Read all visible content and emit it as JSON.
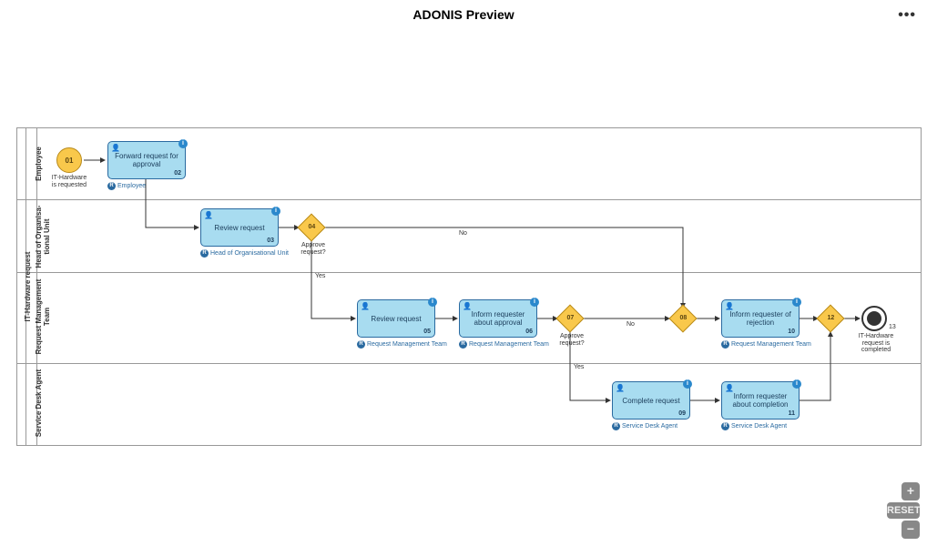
{
  "header": {
    "title": "ADONIS Preview"
  },
  "controls": {
    "reset": "RESET",
    "zoom_in": "+",
    "zoom_out": "−"
  },
  "pool": {
    "name": "IT-Hardware request"
  },
  "lanes": [
    {
      "id": "employee",
      "name": "Employee"
    },
    {
      "id": "head",
      "name": "Head of Organisa-\ntional Unit"
    },
    {
      "id": "rmt",
      "name": "Request Management Team"
    },
    {
      "id": "sda",
      "name": "Service Desk Agent"
    }
  ],
  "events": {
    "start": {
      "num": "01",
      "label": "IT-Hardware\nis requested"
    },
    "end": {
      "num": "13",
      "label": "IT-Hardware\nrequest is\ncompleted"
    }
  },
  "gateways": {
    "g04": {
      "num": "04",
      "label": "Approve\nrequest?"
    },
    "g07": {
      "num": "07",
      "label": "Approve\nrequest?"
    },
    "g08": {
      "num": "08"
    },
    "g12": {
      "num": "12"
    }
  },
  "edges": {
    "g04_no": "No",
    "g04_yes": "Yes",
    "g07_no": "No",
    "g07_yes": "Yes"
  },
  "tasks": {
    "t02": {
      "label": "Forward request for\napproval",
      "num": "02",
      "role": "Employee"
    },
    "t03": {
      "label": "Review request",
      "num": "03",
      "role": "Head of Organisational Unit"
    },
    "t05": {
      "label": "Review request",
      "num": "05",
      "role": "Request Management Team"
    },
    "t06": {
      "label": "Inform requester\nabout approval",
      "num": "06",
      "role": "Request Management Team"
    },
    "t09": {
      "label": "Complete request",
      "num": "09",
      "role": "Service Desk Agent"
    },
    "t10": {
      "label": "Inform requester of\nrejection",
      "num": "10",
      "role": "Request Management Team"
    },
    "t11": {
      "label": "Inform requester\nabout completion",
      "num": "11",
      "role": "Service Desk Agent"
    }
  }
}
